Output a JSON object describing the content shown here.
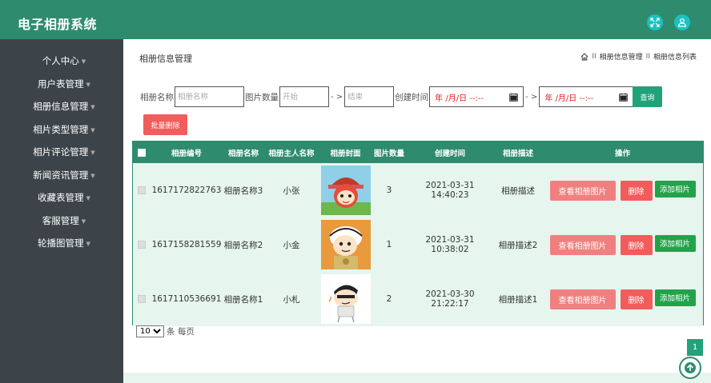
{
  "app": {
    "title": "电子相册系统"
  },
  "sidebar": {
    "items": [
      {
        "label": "个人中心"
      },
      {
        "label": "用户表管理"
      },
      {
        "label": "相册信息管理"
      },
      {
        "label": "相片类型管理"
      },
      {
        "label": "相片评论管理"
      },
      {
        "label": "新闻资讯管理"
      },
      {
        "label": "收藏表管理"
      },
      {
        "label": "客服管理"
      },
      {
        "label": "轮播图管理"
      }
    ]
  },
  "header": {
    "page_title": "相册信息管理",
    "breadcrumb": {
      "sep": "II",
      "item1": "相册信息管理",
      "item2": "相册信息列表"
    }
  },
  "search": {
    "name_label": "相册名称",
    "name_placeholder": "相册名称",
    "count_label": "图片数量",
    "count_start_placeholder": "开始",
    "range_arrow": "- >",
    "count_end_placeholder": "结束",
    "time_label": "创建时间",
    "date_value": "年 /月/日 --:--",
    "query_button": "查询",
    "batch_delete_button": "批量删除"
  },
  "table": {
    "headers": [
      "相册编号",
      "相册名称",
      "相册主人名称",
      "相册封面",
      "图片数量",
      "创建时间",
      "相册描述",
      "操作"
    ],
    "rows": [
      {
        "id": "1617172822763",
        "name": "相册名称3",
        "owner": "小张",
        "count": "3",
        "time": "2021-03-31 14:40:23",
        "desc": "相册描述"
      },
      {
        "id": "1617158281559",
        "name": "相册名称2",
        "owner": "小金",
        "count": "1",
        "time": "2021-03-31 10:38:02",
        "desc": "相册描述2"
      },
      {
        "id": "1617110536691",
        "name": "相册名称1",
        "owner": "小札",
        "count": "2",
        "time": "2021-03-30 21:22:17",
        "desc": "相册描述1"
      }
    ],
    "actions": {
      "view": "查看相册图片",
      "delete": "删除",
      "add": "添加相片"
    }
  },
  "pager": {
    "page_size": "10",
    "per_page_label": "条 每页",
    "current_page": "1"
  },
  "colors": {
    "primary": "#2e8b6e",
    "sidebar": "#3d4449",
    "danger": "#f25c5c",
    "success": "#22a34a"
  }
}
